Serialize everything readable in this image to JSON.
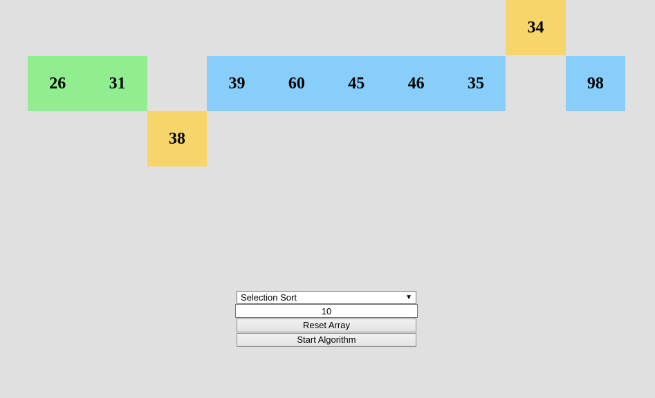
{
  "array": {
    "cells": [
      {
        "value": "26",
        "state": "sorted",
        "row": 1
      },
      {
        "value": "31",
        "state": "sorted",
        "row": 1
      },
      {
        "value": "38",
        "state": "active",
        "row": 2
      },
      {
        "value": "39",
        "state": "unsorted",
        "row": 1
      },
      {
        "value": "60",
        "state": "unsorted",
        "row": 1
      },
      {
        "value": "45",
        "state": "unsorted",
        "row": 1
      },
      {
        "value": "46",
        "state": "unsorted",
        "row": 1
      },
      {
        "value": "35",
        "state": "unsorted",
        "row": 1
      },
      {
        "value": "34",
        "state": "active",
        "row": 0
      },
      {
        "value": "98",
        "state": "unsorted",
        "row": 1
      }
    ]
  },
  "controls": {
    "algorithm_selected": "Selection Sort",
    "array_size": "10",
    "reset_label": "Reset Array",
    "start_label": "Start Algorithm"
  },
  "colors": {
    "background": "#e0e0e0",
    "sorted": "#90ee90",
    "unsorted": "#87cefa",
    "active": "#f7d56a"
  },
  "icons": {
    "select_arrow": "dropdown-arrow-icon"
  }
}
